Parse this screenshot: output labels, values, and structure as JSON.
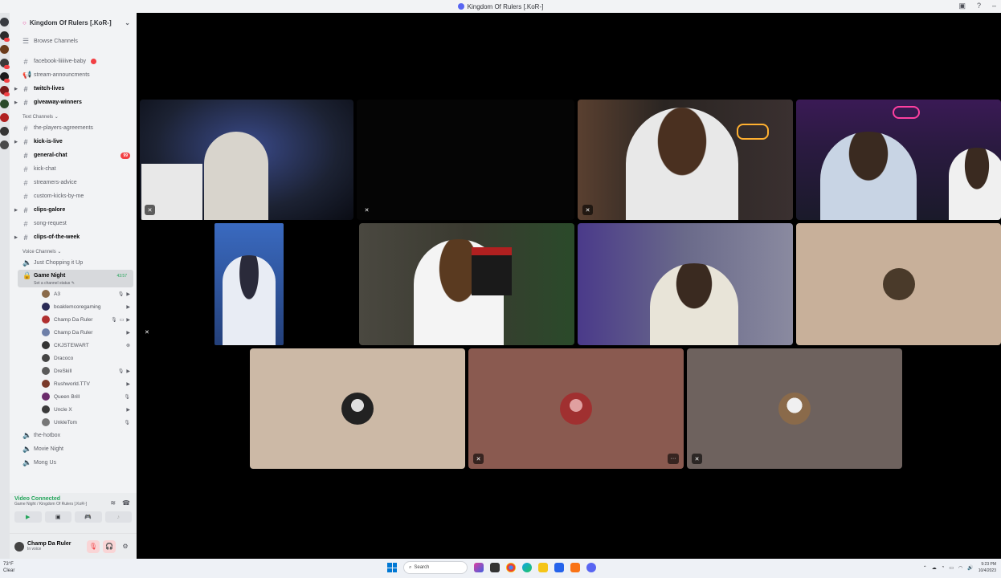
{
  "window": {
    "title": "Kingdom Of Rulers [.KoR-]"
  },
  "server": {
    "name": "Kingdom Of Rulers [.KoR-]"
  },
  "sidebar": {
    "browse_label": "Browse Channels",
    "channels_top": [
      {
        "name": "facebook-liiiiive-baby",
        "bold": false
      },
      {
        "name": "stream-announcments",
        "bold": false
      },
      {
        "name": "twitch-lives",
        "bold": true
      },
      {
        "name": "giveaway-winners",
        "bold": true
      }
    ],
    "text_category": "Text Channels",
    "text_channels": [
      {
        "name": "the-players-agreements",
        "bold": false
      },
      {
        "name": "kick-is-live",
        "bold": true
      },
      {
        "name": "general-chat",
        "bold": true,
        "mention": "99"
      },
      {
        "name": "kick-chat",
        "bold": false
      },
      {
        "name": "streamers-advice",
        "bold": false
      },
      {
        "name": "custom-kicks-by-me",
        "bold": false
      },
      {
        "name": "clips-galore",
        "bold": true
      },
      {
        "name": "song-request",
        "bold": false
      },
      {
        "name": "clips-of-the-week",
        "bold": true
      }
    ],
    "voice_category": "Voice Channels",
    "voice_channels_before": [
      {
        "name": "Just Chopping it Up"
      }
    ],
    "active_voice": {
      "name": "Game Night",
      "timer": "43:57",
      "status": "Set a channel status"
    },
    "voice_users": [
      {
        "name": "A3",
        "color": "#8a6a4a"
      },
      {
        "name": "boaklemcoregaming",
        "color": "#2a2a55"
      },
      {
        "name": "Champ Da Ruler",
        "color": "#b03030"
      },
      {
        "name": "Champ Da Ruler",
        "color": "#6e7fa8"
      },
      {
        "name": "CKJSTEWART",
        "color": "#333333"
      },
      {
        "name": "Dracoco",
        "color": "#444444"
      },
      {
        "name": "DreSkill",
        "color": "#5a5a5a"
      },
      {
        "name": "Rushworld.TTV",
        "color": "#7a3a2a"
      },
      {
        "name": "Queen Brill",
        "color": "#6a2a6a"
      },
      {
        "name": "Uncle X",
        "color": "#3a3a3a"
      },
      {
        "name": "UnkleTom",
        "color": "#777777"
      }
    ],
    "voice_channels_after": [
      {
        "name": "the-hotbox"
      },
      {
        "name": "Movie Night"
      },
      {
        "name": "Mong Us"
      }
    ]
  },
  "voice_connection": {
    "title": "Video Connected",
    "subtitle": "Game Night / Kingdom Of Rulers [.KoR-]"
  },
  "user": {
    "name": "Champ Da Ruler",
    "status": "In voice"
  },
  "tiles": [
    {
      "kind": "video",
      "bg": "#1c2233",
      "accent": "#3a4a8a",
      "mic_off": true
    },
    {
      "kind": "video",
      "bg": "#060606",
      "accent": "#111111",
      "mic_off": true
    },
    {
      "kind": "video",
      "bg": "#2a2522",
      "accent": "#5a4a3a",
      "mic_off": true
    },
    {
      "kind": "video",
      "bg": "#2a1a40",
      "accent": "#6a2a7a",
      "mic_off": false
    },
    {
      "kind": "video",
      "bg": "#24407a",
      "accent": "#4a7ad0",
      "mic_off": false
    },
    {
      "kind": "video",
      "bg": "#3a3a30",
      "accent": "#4a6a3a",
      "mic_off": false
    },
    {
      "kind": "video",
      "bg": "#2a2a48",
      "accent": "#5a5aa0",
      "mic_off": false
    },
    {
      "kind": "avatar",
      "bg": "#c8b09a",
      "avatar_color": "#4a3a2a",
      "mic_off": false
    },
    {
      "kind": "avatar",
      "bg": "#ccb9a6",
      "avatar_color": "#333333",
      "mic_off": false
    },
    {
      "kind": "avatar",
      "bg": "#8a5a50",
      "avatar_color": "#a03030",
      "mic_off": true,
      "more": true
    },
    {
      "kind": "avatar",
      "bg": "#6e625e",
      "avatar_color": "#bcb0a0",
      "mic_off": true
    }
  ],
  "taskbar": {
    "weather_temp": "73°F",
    "weather_desc": "Clear",
    "search_placeholder": "Search",
    "time": "9:23 PM",
    "date": "10/4/2023"
  }
}
